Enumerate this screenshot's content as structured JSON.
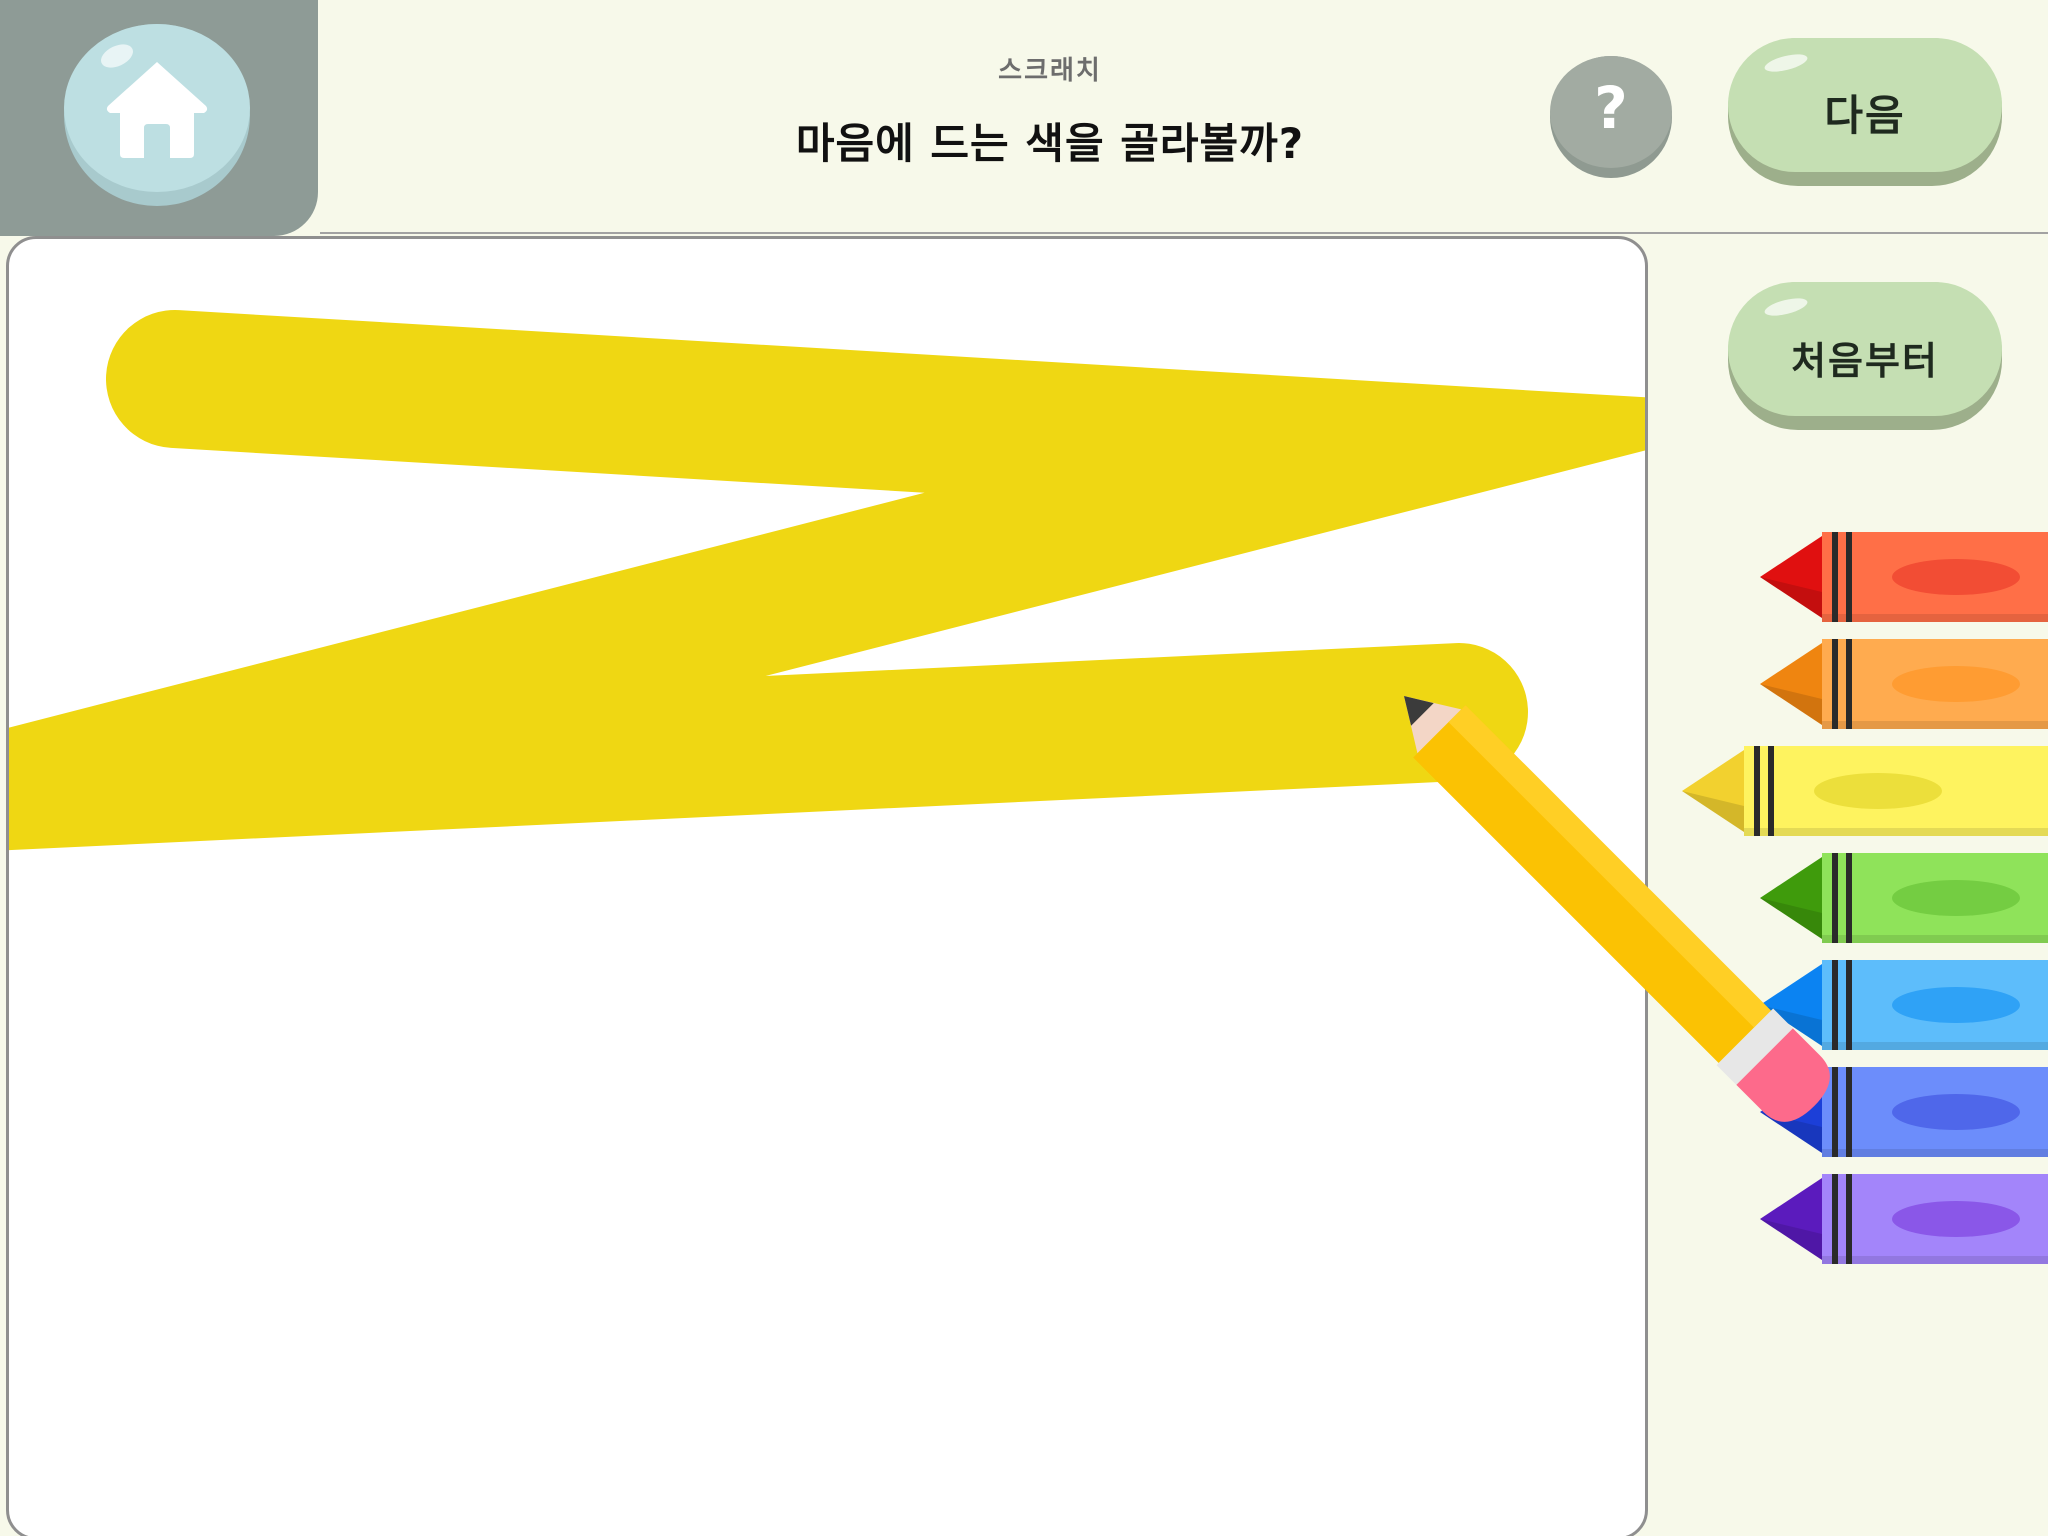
{
  "header": {
    "subtitle": "스크래치",
    "title": "마음에 드는 색을 골라볼까?",
    "help_label": "?",
    "next_label": "다음"
  },
  "sidebar": {
    "restart_label": "처음부터"
  },
  "icons": {
    "home": "home-icon",
    "help": "question-icon",
    "pencil": "pencil-icon"
  },
  "drawing": {
    "stroke_color": "#efd713"
  },
  "crayons": [
    {
      "name": "red",
      "tip": "#e01010",
      "body": "#ff6f47",
      "oval": "#f24d34",
      "selected": false
    },
    {
      "name": "orange",
      "tip": "#ef8510",
      "body": "#ffab4f",
      "oval": "#ff9c32",
      "selected": false
    },
    {
      "name": "yellow",
      "tip": "#f2d12f",
      "body": "#fef35f",
      "oval": "#ecdf3b",
      "selected": true
    },
    {
      "name": "green",
      "tip": "#3f9b0c",
      "body": "#8fe35a",
      "oval": "#74cd42",
      "selected": false
    },
    {
      "name": "sky-blue",
      "tip": "#0b83f2",
      "body": "#5dbdfb",
      "oval": "#2fa2f6",
      "selected": false
    },
    {
      "name": "blue",
      "tip": "#1c3fd8",
      "body": "#6c8dfb",
      "oval": "#4f67ea",
      "selected": false
    },
    {
      "name": "purple",
      "tip": "#5b1bbd",
      "body": "#a385fa",
      "oval": "#8a57e8",
      "selected": false
    }
  ]
}
